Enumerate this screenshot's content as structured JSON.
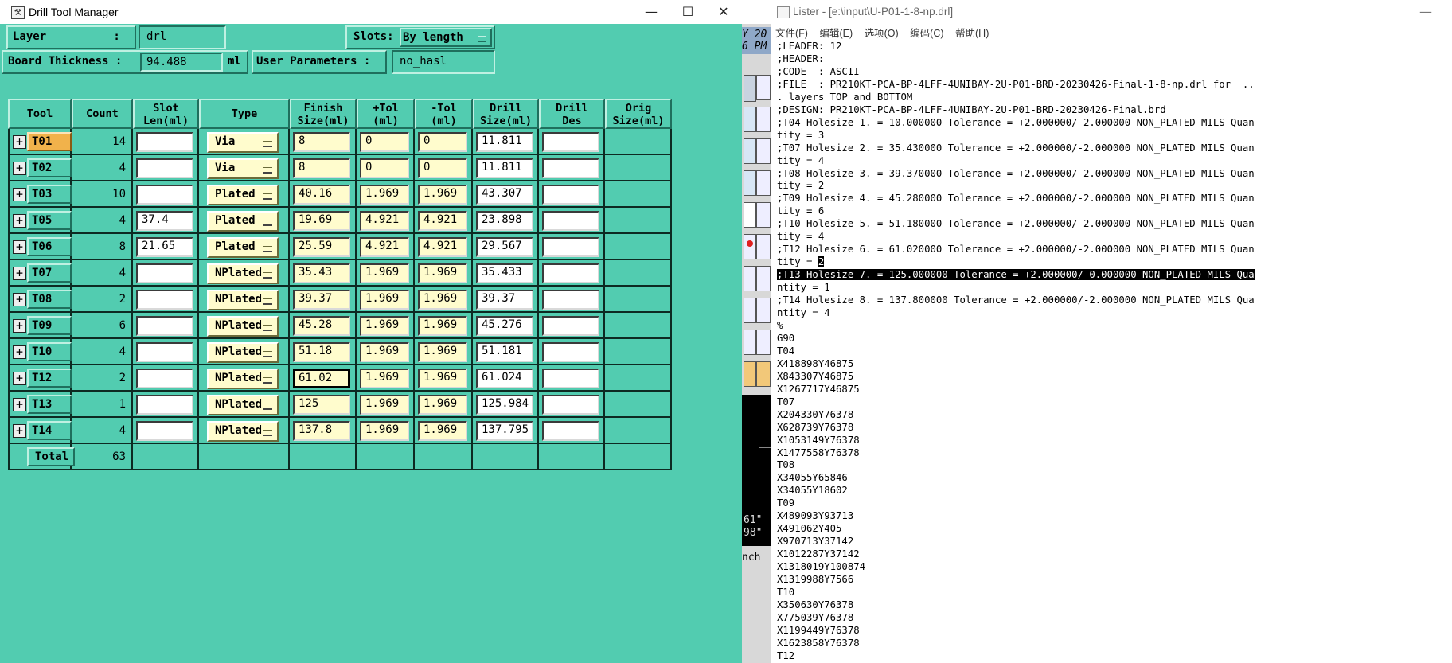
{
  "drill_window": {
    "title": "Drill Tool Manager",
    "controls": {
      "minimize": "—",
      "maximize": "☐",
      "close": "✕"
    },
    "layer_label": "Layer          :",
    "layer_value": "drl",
    "slots_label": "Slots:",
    "slots_value": "By length",
    "board_thickness_label": "Board Thickness :",
    "board_thickness_value": "94.488",
    "board_thickness_unit": "ml",
    "user_params_label": "User Parameters :",
    "user_params_value": "no_hasl",
    "columns": [
      {
        "line1": "Tool",
        "line2": ""
      },
      {
        "line1": "Count",
        "line2": ""
      },
      {
        "line1": "Slot",
        "line2": "Len(ml)"
      },
      {
        "line1": "Type",
        "line2": ""
      },
      {
        "line1": "Finish",
        "line2": "Size(ml)"
      },
      {
        "line1": "+Tol",
        "line2": "(ml)"
      },
      {
        "line1": "-Tol",
        "line2": "(ml)"
      },
      {
        "line1": "Drill",
        "line2": "Size(ml)"
      },
      {
        "line1": "Drill",
        "line2": "Des"
      },
      {
        "line1": "Orig",
        "line2": "Size(ml)"
      }
    ],
    "rows": [
      {
        "tool": "T01",
        "count": "14",
        "slot": "",
        "type": "Via",
        "finish": "8",
        "ptol": "0",
        "mtol": "0",
        "drill": "11.811",
        "des": "",
        "selected": true
      },
      {
        "tool": "T02",
        "count": "4",
        "slot": "",
        "type": "Via",
        "finish": "8",
        "ptol": "0",
        "mtol": "0",
        "drill": "11.811",
        "des": ""
      },
      {
        "tool": "T03",
        "count": "10",
        "slot": "",
        "type": "Plated",
        "finish": "40.16",
        "ptol": "1.969",
        "mtol": "1.969",
        "drill": "43.307",
        "des": ""
      },
      {
        "tool": "T05",
        "count": "4",
        "slot": "37.4",
        "type": "Plated",
        "finish": "19.69",
        "ptol": "4.921",
        "mtol": "4.921",
        "drill": "23.898",
        "des": ""
      },
      {
        "tool": "T06",
        "count": "8",
        "slot": "21.65",
        "type": "Plated",
        "finish": "25.59",
        "ptol": "4.921",
        "mtol": "4.921",
        "drill": "29.567",
        "des": ""
      },
      {
        "tool": "T07",
        "count": "4",
        "slot": "",
        "type": "NPlated",
        "finish": "35.43",
        "ptol": "1.969",
        "mtol": "1.969",
        "drill": "35.433",
        "des": ""
      },
      {
        "tool": "T08",
        "count": "2",
        "slot": "",
        "type": "NPlated",
        "finish": "39.37",
        "ptol": "1.969",
        "mtol": "1.969",
        "drill": "39.37",
        "des": ""
      },
      {
        "tool": "T09",
        "count": "6",
        "slot": "",
        "type": "NPlated",
        "finish": "45.28",
        "ptol": "1.969",
        "mtol": "1.969",
        "drill": "45.276",
        "des": ""
      },
      {
        "tool": "T10",
        "count": "4",
        "slot": "",
        "type": "NPlated",
        "finish": "51.18",
        "ptol": "1.969",
        "mtol": "1.969",
        "drill": "51.181",
        "des": ""
      },
      {
        "tool": "T12",
        "count": "2",
        "slot": "",
        "type": "NPlated",
        "finish": "61.02",
        "ptol": "1.969",
        "mtol": "1.969",
        "drill": "61.024",
        "des": "",
        "focused": true
      },
      {
        "tool": "T13",
        "count": "1",
        "slot": "",
        "type": "NPlated",
        "finish": "125",
        "ptol": "1.969",
        "mtol": "1.969",
        "drill": "125.984",
        "des": ""
      },
      {
        "tool": "T14",
        "count": "4",
        "slot": "",
        "type": "NPlated",
        "finish": "137.8",
        "ptol": "1.969",
        "mtol": "1.969",
        "drill": "137.795",
        "des": ""
      }
    ],
    "total_label": "Total",
    "total_value": "63"
  },
  "background_app": {
    "fragments": [
      "Y 20",
      "6 PM",
      "61\"",
      "98\"",
      "nch"
    ]
  },
  "lister": {
    "title": "Lister - [e:\\input\\U-P01-1-8-np.drl]",
    "menu": [
      "文件(F)",
      "编辑(E)",
      "选项(O)",
      "编码(C)",
      "帮助(H)"
    ],
    "lines": [
      ";LEADER: 12",
      ";HEADER:",
      ";CODE  : ASCII",
      ";FILE  : PR210KT-PCA-BP-4LFF-4UNIBAY-2U-P01-BRD-20230426-Final-1-8-np.drl for  ..",
      ". layers TOP and BOTTOM",
      ";DESIGN: PR210KT-PCA-BP-4LFF-4UNIBAY-2U-P01-BRD-20230426-Final.brd",
      ";T04 Holesize 1. = 10.000000 Tolerance = +2.000000/-2.000000 NON_PLATED MILS Quan",
      "tity = 3",
      ";T07 Holesize 2. = 35.430000 Tolerance = +2.000000/-2.000000 NON_PLATED MILS Quan",
      "tity = 4",
      ";T08 Holesize 3. = 39.370000 Tolerance = +2.000000/-2.000000 NON_PLATED MILS Quan",
      "tity = 2",
      ";T09 Holesize 4. = 45.280000 Tolerance = +2.000000/-2.000000 NON_PLATED MILS Quan",
      "tity = 6",
      ";T10 Holesize 5. = 51.180000 Tolerance = +2.000000/-2.000000 NON_PLATED MILS Quan",
      "tity = 4",
      ";T12 Holesize 6. = 61.020000 Tolerance = +2.000000/-2.000000 NON_PLATED MILS Quan",
      "tity = 2",
      ";T13 Holesize 7. = 125.000000 Tolerance = +2.000000/-0.000000 NON_PLATED MILS Qua",
      "ntity = 1",
      ";T14 Holesize 8. = 137.800000 Tolerance = +2.000000/-2.000000 NON_PLATED MILS Qua",
      "ntity = 4",
      "%",
      "G90",
      "T04",
      "X418898Y46875",
      "X843307Y46875",
      "X1267717Y46875",
      "T07",
      "X204330Y76378",
      "X628739Y76378",
      "X1053149Y76378",
      "X1477558Y76378",
      "T08",
      "X34055Y65846",
      "X34055Y18602",
      "T09",
      "X489093Y93713",
      "X491062Y405",
      "X970713Y37142",
      "X1012287Y37142",
      "X1318019Y100874",
      "X1319988Y7566",
      "T10",
      "X350630Y76378",
      "X775039Y76378",
      "X1199449Y76378",
      "X1623858Y76378",
      "T12"
    ],
    "selection": {
      "line": 18,
      "partial_line": 17,
      "partial_text": "2"
    }
  }
}
